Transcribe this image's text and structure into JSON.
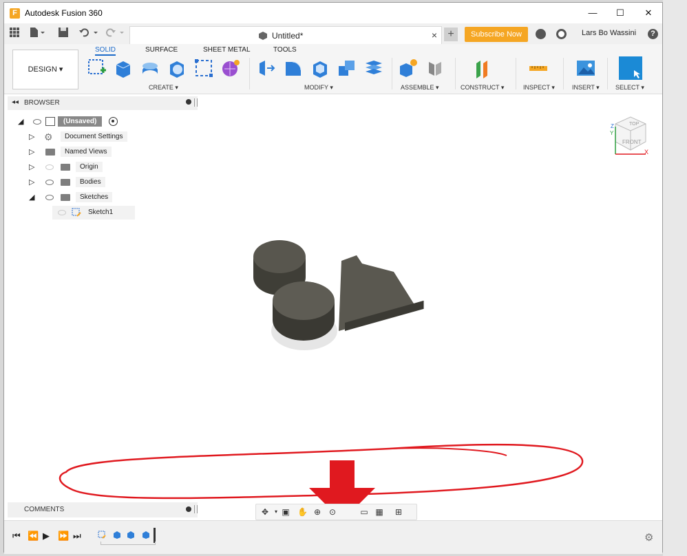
{
  "window": {
    "title": "Autodesk Fusion 360",
    "app_icon": "F"
  },
  "window_controls": {
    "minimize": "—",
    "maximize": "☐",
    "close": "✕"
  },
  "tabbar": {
    "doc_title": "Untitled*",
    "close_tab": "×",
    "new_tab": "+",
    "subscribe_label": "Subscribe Now",
    "user_name": "Lars Bo Wassini",
    "help": "?"
  },
  "toolbar": {
    "design_label": "DESIGN ▾",
    "workspace_tabs": [
      "SOLID",
      "SURFACE",
      "SHEET METAL",
      "TOOLS"
    ],
    "groups": {
      "create": "CREATE ▾",
      "modify": "MODIFY ▾",
      "assemble": "ASSEMBLE ▾",
      "construct": "CONSTRUCT ▾",
      "inspect": "INSPECT ▾",
      "insert": "INSERT ▾",
      "select": "SELECT ▾"
    }
  },
  "browser": {
    "header": "BROWSER",
    "root_label": "(Unsaved)",
    "items": [
      {
        "label": "Document Settings",
        "icon": "gear-icon"
      },
      {
        "label": "Named Views",
        "icon": "folder-icon"
      },
      {
        "label": "Origin",
        "icon": "folder-icon"
      },
      {
        "label": "Bodies",
        "icon": "folder-icon"
      },
      {
        "label": "Sketches",
        "icon": "folder-icon"
      },
      {
        "label": "Sketch1",
        "icon": "sketch-icon"
      }
    ]
  },
  "viewcube": {
    "top": "TOP",
    "front": "FRONT",
    "axis_z": "Z",
    "axis_y": "Y",
    "axis_x": "X"
  },
  "comments": {
    "label": "COMMENTS"
  },
  "annotation": {
    "ellipse_color": "#e0191f",
    "arrow_color": "#e0191f"
  },
  "colors": {
    "accent": "#1b6ac9",
    "subscribe": "#f5a623",
    "model": "#57554c"
  }
}
